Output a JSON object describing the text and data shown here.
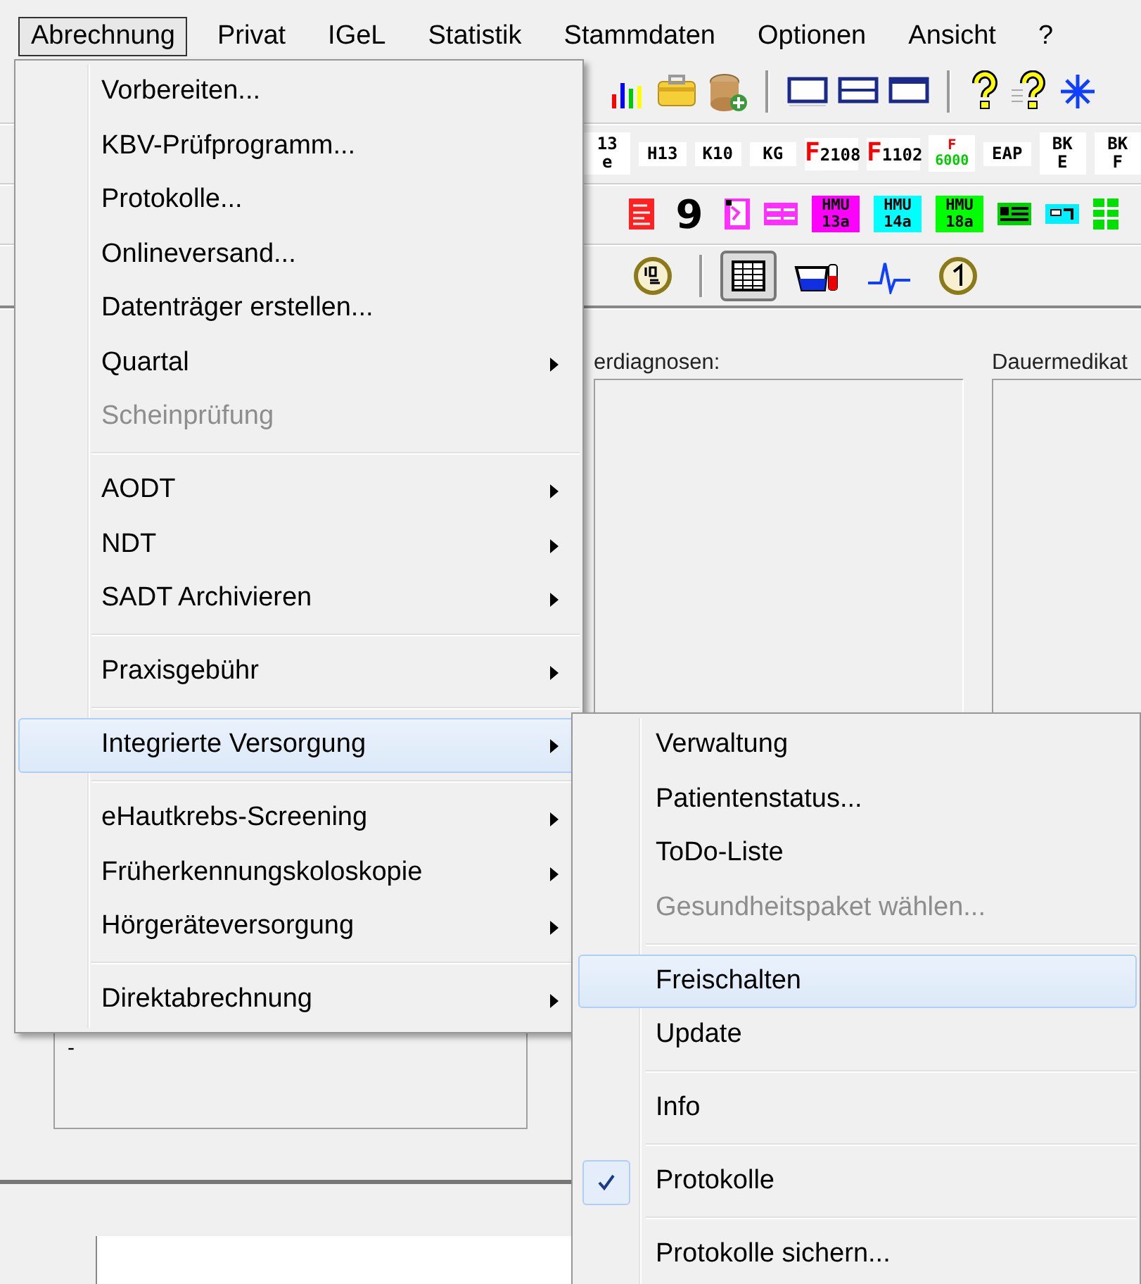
{
  "menubar": [
    {
      "label": "Abrechnung",
      "selected": true
    },
    {
      "label": "Privat",
      "selected": false
    },
    {
      "label": "IGeL",
      "selected": false
    },
    {
      "label": "Statistik",
      "selected": false
    },
    {
      "label": "Stammdaten",
      "selected": false
    },
    {
      "label": "Optionen",
      "selected": false
    },
    {
      "label": "Ansicht",
      "selected": false
    },
    {
      "label": "?",
      "selected": false
    }
  ],
  "toolbar_1": [
    {
      "kind": "bar-chart"
    },
    {
      "kind": "toolbox"
    },
    {
      "kind": "coins-add"
    },
    {
      "kind": "separator"
    },
    {
      "kind": "window-plain"
    },
    {
      "kind": "window-split"
    },
    {
      "kind": "window-title"
    },
    {
      "kind": "separator"
    },
    {
      "kind": "help"
    },
    {
      "kind": "help-lines"
    },
    {
      "kind": "asterisk"
    }
  ],
  "toolbar_2": [
    {
      "kind": "text",
      "label": "13\ne"
    },
    {
      "kind": "text",
      "label": "H13"
    },
    {
      "kind": "text",
      "label": "K10"
    },
    {
      "kind": "text",
      "label": "KG"
    },
    {
      "kind": "red-initial",
      "label": "F2108"
    },
    {
      "kind": "red-initial",
      "label": "F1102"
    },
    {
      "kind": "red-top",
      "label": "F\n6000"
    },
    {
      "kind": "text",
      "label": "EAP"
    },
    {
      "kind": "text",
      "label": "BK\nE"
    },
    {
      "kind": "text",
      "label": "BK\nF"
    }
  ],
  "toolbar_3": [
    {
      "kind": "red-form"
    },
    {
      "kind": "big-text",
      "label": "9"
    },
    {
      "kind": "pink-doc"
    },
    {
      "kind": "pink-form"
    },
    {
      "kind": "tile",
      "label": "HMU\n13a",
      "color": "#ff00ff"
    },
    {
      "kind": "tile",
      "label": "HMU\n14a",
      "color": "#00ffff"
    },
    {
      "kind": "tile",
      "label": "HMU\n18a",
      "color": "#00ff00"
    },
    {
      "kind": "green-list"
    },
    {
      "kind": "cyan-card"
    },
    {
      "kind": "green-grid"
    }
  ],
  "toolbar_4": [
    {
      "kind": "coin-10",
      "selected": false
    },
    {
      "kind": "separator"
    },
    {
      "kind": "table",
      "selected": true
    },
    {
      "kind": "jug",
      "selected": false
    },
    {
      "kind": "ecg",
      "selected": false
    },
    {
      "kind": "coin-1",
      "selected": false
    }
  ],
  "panels": [
    {
      "label": "erdiagnosen:"
    },
    {
      "label": "Dauermedikat"
    }
  ],
  "note_text": "-",
  "menu": {
    "items": [
      {
        "kind": "item",
        "label": "Vorbereiten...",
        "disabled": false,
        "submenu": false,
        "selected": false
      },
      {
        "kind": "item",
        "label": "KBV-Prüfprogramm...",
        "disabled": false,
        "submenu": false,
        "selected": false
      },
      {
        "kind": "item",
        "label": "Protokolle...",
        "disabled": false,
        "submenu": false,
        "selected": false
      },
      {
        "kind": "item",
        "label": "Onlineversand...",
        "disabled": false,
        "submenu": false,
        "selected": false
      },
      {
        "kind": "item",
        "label": "Datenträger erstellen...",
        "disabled": false,
        "submenu": false,
        "selected": false
      },
      {
        "kind": "item",
        "label": "Quartal",
        "disabled": false,
        "submenu": true,
        "selected": false
      },
      {
        "kind": "item",
        "label": "Scheinprüfung",
        "disabled": true,
        "submenu": false,
        "selected": false
      },
      {
        "kind": "separator"
      },
      {
        "kind": "item",
        "label": "AODT",
        "disabled": false,
        "submenu": true,
        "selected": false
      },
      {
        "kind": "item",
        "label": "NDT",
        "disabled": false,
        "submenu": true,
        "selected": false
      },
      {
        "kind": "item",
        "label": "SADT Archivieren",
        "disabled": false,
        "submenu": true,
        "selected": false
      },
      {
        "kind": "separator"
      },
      {
        "kind": "item",
        "label": "Praxisgebühr",
        "disabled": false,
        "submenu": true,
        "selected": false
      },
      {
        "kind": "separator"
      },
      {
        "kind": "item",
        "label": "Integrierte Versorgung",
        "disabled": false,
        "submenu": true,
        "selected": true
      },
      {
        "kind": "separator"
      },
      {
        "kind": "item",
        "label": "eHautkrebs-Screening",
        "disabled": false,
        "submenu": true,
        "selected": false
      },
      {
        "kind": "item",
        "label": "Früherkennungskoloskopie",
        "disabled": false,
        "submenu": true,
        "selected": false
      },
      {
        "kind": "item",
        "label": "Hörgeräteversorgung",
        "disabled": false,
        "submenu": true,
        "selected": false
      },
      {
        "kind": "separator"
      },
      {
        "kind": "item",
        "label": "Direktabrechnung",
        "disabled": false,
        "submenu": true,
        "selected": false
      }
    ]
  },
  "submenu": {
    "items": [
      {
        "kind": "item",
        "label": "Verwaltung",
        "disabled": false,
        "checked": false,
        "selected": false
      },
      {
        "kind": "item",
        "label": "Patientenstatus...",
        "disabled": false,
        "checked": false,
        "selected": false
      },
      {
        "kind": "item",
        "label": "ToDo-Liste",
        "disabled": false,
        "checked": false,
        "selected": false
      },
      {
        "kind": "item",
        "label": "Gesundheitspaket wählen...",
        "disabled": true,
        "checked": false,
        "selected": false
      },
      {
        "kind": "separator"
      },
      {
        "kind": "item",
        "label": "Freischalten",
        "disabled": false,
        "checked": false,
        "selected": true
      },
      {
        "kind": "item",
        "label": "Update",
        "disabled": false,
        "checked": false,
        "selected": false
      },
      {
        "kind": "separator"
      },
      {
        "kind": "item",
        "label": "Info",
        "disabled": false,
        "checked": false,
        "selected": false
      },
      {
        "kind": "separator"
      },
      {
        "kind": "item",
        "label": "Protokolle",
        "disabled": false,
        "checked": true,
        "selected": false
      },
      {
        "kind": "separator"
      },
      {
        "kind": "item",
        "label": "Protokolle sichern...",
        "disabled": false,
        "checked": false,
        "selected": false
      }
    ]
  }
}
